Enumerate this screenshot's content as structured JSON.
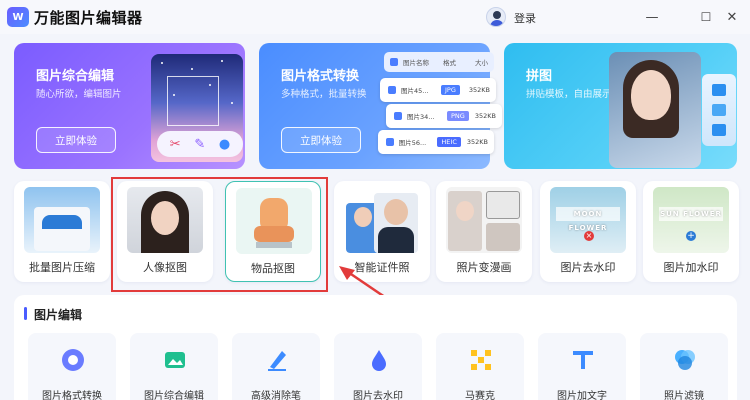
{
  "app": {
    "title": "万能图片编辑器",
    "logo_text": "W"
  },
  "titlebar": {
    "login": "登录",
    "minimize": "—",
    "maximize": "☐",
    "close": "✕"
  },
  "features": [
    {
      "title": "图片综合编辑",
      "subtitle": "随心所欲，编辑图片",
      "button": "立即体验"
    },
    {
      "title": "图片格式转换",
      "subtitle": "多种格式，批量转换",
      "button": "立即体验"
    },
    {
      "title": "拼图",
      "subtitle": "拼贴模板，自由展示"
    }
  ],
  "format_panel": {
    "header": {
      "name": "图片名称",
      "format": "格式",
      "size": "大小"
    },
    "rows": [
      {
        "name": "图片45...",
        "format": "JPG",
        "size": "352KB",
        "color": "#4a7dff"
      },
      {
        "name": "图片34...",
        "format": "PNG",
        "size": "352KB",
        "color": "#7a8bff"
      },
      {
        "name": "图片56...",
        "format": "HEIC",
        "size": "352KB",
        "color": "#4a6cff"
      }
    ]
  },
  "tools": [
    {
      "label": "批量图片压缩"
    },
    {
      "label": "人像抠图"
    },
    {
      "label": "物品抠图"
    },
    {
      "label": "智能证件照"
    },
    {
      "label": "照片变漫画"
    },
    {
      "label": "图片去水印",
      "watermark": "MOON FLOWER"
    },
    {
      "label": "图片加水印",
      "watermark": "SUN FLOWER"
    }
  ],
  "edit_section": {
    "title": "图片编辑",
    "items": [
      {
        "label": "图片格式转换",
        "icon": "format-convert-icon",
        "color": "#5a6cff"
      },
      {
        "label": "图片综合编辑",
        "icon": "edit-image-icon",
        "color": "#1fbf8f"
      },
      {
        "label": "高级消除笔",
        "icon": "eraser-pen-icon",
        "color": "#3c8bff"
      },
      {
        "label": "图片去水印",
        "icon": "remove-watermark-icon",
        "color": "#4a6cff"
      },
      {
        "label": "马赛克",
        "icon": "mosaic-icon",
        "color": "#ffc21f"
      },
      {
        "label": "图片加文字",
        "icon": "add-text-icon",
        "color": "#3c8bff"
      },
      {
        "label": "照片滤镜",
        "icon": "photo-filter-icon",
        "color": "#2aa3ff"
      }
    ]
  },
  "colors": {
    "accent": "#4a5cff",
    "selection_border": "#40c2b2",
    "annotation_red": "#e23b3b"
  }
}
